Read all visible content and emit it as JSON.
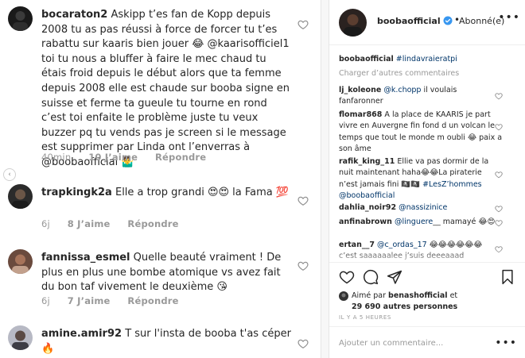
{
  "left_comments": [
    {
      "username": "bocaraton2",
      "text": "Askipp t’es fan de Kopp depuis 2008 tu as pas réussi à force de forcer tu t’es rabattu sur kaaris bien jouer 😂 @kaarisofficiel1 toi tu nous a bluffer à faire le mec chaud tu étais froid depuis le début alors que ta femme depuis 2008 elle est chaude sur booba signe en suisse et ferme ta gueule tu tourne en rond c’est toi enfaite le problème juste tu veux buzzer pq tu vends pas je screen si le message est supprimer par Linda ont l’enverras à @boobaofficial 🤷‍♂️",
      "time": "40min",
      "likes": "10 J’aime",
      "reply": "Répondre"
    },
    {
      "username": "trapkingk2a",
      "text": "Elle a trop grandi 😍😍 la Fama 💯",
      "time": "6j",
      "likes": "8 J’aime",
      "reply": "Répondre"
    },
    {
      "username": "fannissa_esmel",
      "text": "Quelle beauté vraiment ! De plus en plus une bombe atomique vs avez fait du bon taf vivement le deuxième 😘",
      "time": "6j",
      "likes": "7 J’aime",
      "reply": "Répondre"
    },
    {
      "username": "amine.amir92",
      "text": "T sur l'insta de booba t'as céper 🔥",
      "time": "",
      "likes": "",
      "reply": ""
    }
  ],
  "right": {
    "header": {
      "username": "boobaofficial",
      "separator": "•",
      "follow_status": "Abonné(e)",
      "more": "•••"
    },
    "caption": {
      "username": "boobaofficial",
      "hashtag": "#lindavraieratpi"
    },
    "load_more": "Charger d’autres commentaires",
    "comments": [
      {
        "username": "lj_koleone",
        "mention": "@k.chopp",
        "text": " il voulais fanfaronner"
      },
      {
        "username": "flomar868",
        "mention": "",
        "text": " A la place de KAARIS je part vivre en Auvergne fin fond d un volcan le temps que tout le monde m oubli 😂 paix a son âme"
      },
      {
        "username": "rafik_king_11",
        "mention": "",
        "text": " Ellie va pas dormir de la nuit maintenant haha😂😂La piraterie n’est jamais fini 🏴‍☠️🏴‍☠️ ",
        "tail_link": "#LesZ’hommes @boobaofficial"
      },
      {
        "username": "dahlia_noir92",
        "mention": "@nassizinice",
        "text": ""
      },
      {
        "username": "anfinabrown",
        "mention": "@linguere",
        "text": "__ mamayé 😂😍"
      },
      {
        "username": "ertan__7",
        "mention": "@c_ordas_17",
        "text": " 😂😂😂😂😂😂 c’est saaaaaalee j’suis deeeaaad"
      }
    ],
    "liked_by": {
      "prefix": "Aimé par ",
      "user": "benashofficial",
      "middle": " et",
      "count": "29 690 autres personnes"
    },
    "time_ago": "IL Y A 5 HEURES",
    "add_comment_placeholder": "Ajouter un commentaire...",
    "add_comment_more": "•••"
  }
}
